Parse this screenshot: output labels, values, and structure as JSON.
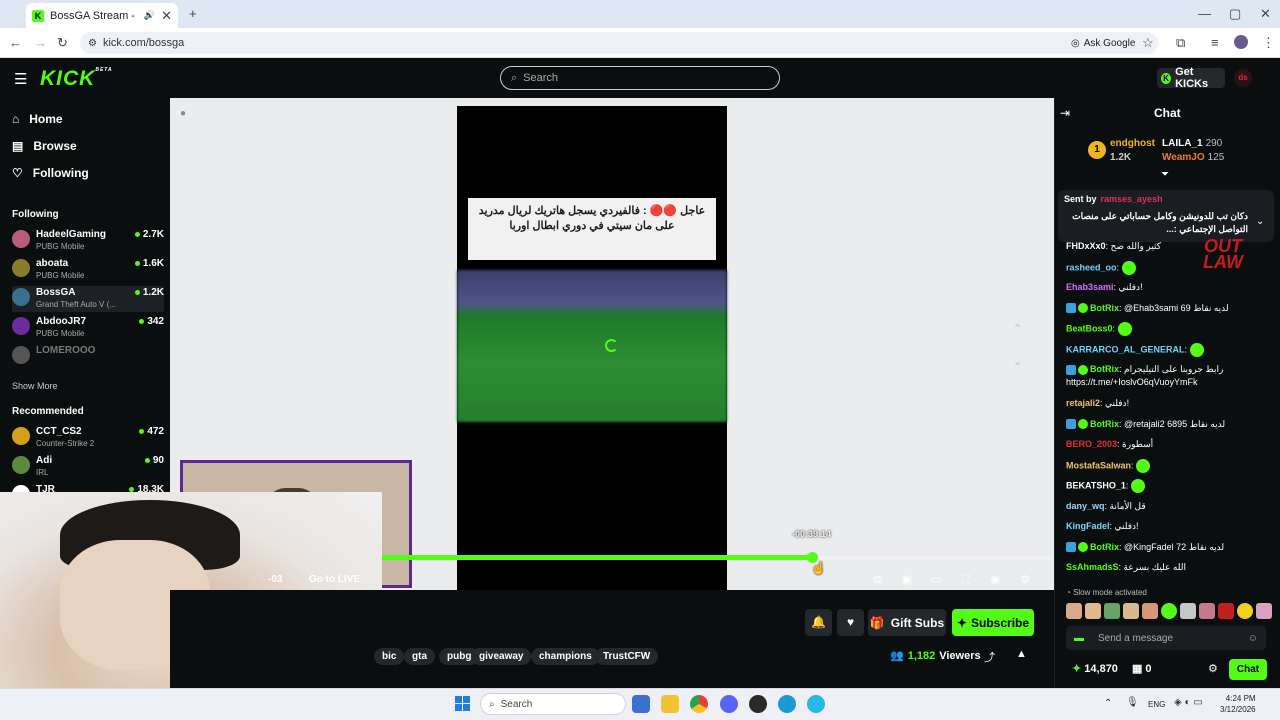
{
  "browser": {
    "tab_title": "BossGA Stream - Watch Live",
    "url": "kick.com/bossga",
    "ask_google": "Ask Google"
  },
  "header": {
    "logo": "KICK",
    "logo_badge": "BETA",
    "search_placeholder": "Search",
    "get_kicks": "Get KICKs"
  },
  "sidebar": {
    "nav": [
      {
        "label": "Home",
        "icon": "home-icon"
      },
      {
        "label": "Browse",
        "icon": "browse-icon"
      },
      {
        "label": "Following",
        "icon": "heart-icon"
      }
    ],
    "following_title": "Following",
    "following": [
      {
        "name": "HadeelGaming",
        "game": "PUBG Mobile",
        "viewers": "2.7K",
        "color": "#b85c7a"
      },
      {
        "name": "aboata",
        "game": "PUBG Mobile",
        "viewers": "1.6K",
        "color": "#8a7a2a"
      },
      {
        "name": "BossGA",
        "game": "Grand Theft Auto V (...",
        "viewers": "1.2K",
        "color": "#3b6e8f"
      },
      {
        "name": "AbdooJR7",
        "game": "PUBG Mobile",
        "viewers": "342",
        "color": "#6a2ca0"
      },
      {
        "name": "LOMEROOO",
        "game": "",
        "viewers": "",
        "color": "#555555"
      }
    ],
    "show_more": "Show More",
    "recommended_title": "Recommended",
    "recommended": [
      {
        "name": "CCT_CS2",
        "game": "Counter-Strike 2",
        "viewers": "472",
        "color": "#d4a017"
      },
      {
        "name": "Adi",
        "game": "IRL",
        "viewers": "90",
        "color": "#5a8a3a"
      },
      {
        "name": "TJR",
        "game": "IRL",
        "viewers": "18.3K",
        "color": "#ffffff"
      }
    ]
  },
  "player": {
    "news_text": "عاجل 🔴🔴 : فالفيردي يسجل هاتريك لريال مدريد على مان سيتي في دوري ابطال اوربا",
    "tooltip_time": "-00:39:14",
    "time": "-03",
    "go_live": "Go to LIVE",
    "progress_fraction": 0.703
  },
  "below": {
    "gift_subs": "Gift Subs",
    "subscribe": "Subscribe",
    "tags": [
      "bic",
      "gta",
      "pubg",
      "giveaway",
      "champions",
      "TrustCFW"
    ],
    "viewers_count": "1,182",
    "viewers_label": "Viewers"
  },
  "chat": {
    "title": "Chat",
    "leaderboard": [
      {
        "rank": "1",
        "name": "endghost",
        "amount": "1.2K"
      },
      {
        "name": "LAILA_1",
        "amount": "290"
      },
      {
        "name": "WeamJO",
        "amount": "125"
      }
    ],
    "pinned_sent_by": "Sent by",
    "pinned_user": "ramses_ayesh",
    "pinned_message": "دكان تب للدونيشن وكامل حساباتي على منصات التواصل الإجتماعي :...",
    "messages": [
      {
        "user": "FHDxXx0",
        "text": "كثير والله صح",
        "color": "#ffffff",
        "bot": false
      },
      {
        "user": "rasheed_oo",
        "text": "",
        "color": "#6fd3ff",
        "bot": false,
        "emote": true
      },
      {
        "user": "Ehab3sami",
        "text": "دفلني!",
        "color": "#d86bff",
        "bot": false
      },
      {
        "user": "BotRix",
        "text": "@Ehab3sami 69 لديه نقاط",
        "color": "#53fc18",
        "bot": true
      },
      {
        "user": "BeatBoss0",
        "text": "",
        "color": "#53fc18",
        "bot": false,
        "emote": true
      },
      {
        "user": "KARRARCO_AL_GENERAL",
        "text": "",
        "color": "#6fd3ff",
        "bot": false,
        "emote": true
      },
      {
        "user": "BotRix",
        "text": "رابط جروبنا على التيليجرام https://t.me/+IoslvO6qVuoyYmFk",
        "color": "#53fc18",
        "bot": true
      },
      {
        "user": "retajali2",
        "text": "دفلني!",
        "color": "#f0c36b",
        "bot": false
      },
      {
        "user": "BotRix",
        "text": "@retajali2 6895 لديه نقاط",
        "color": "#53fc18",
        "bot": true
      },
      {
        "user": "BERO_2003",
        "text": "أسطورة",
        "color": "#e03030",
        "bot": false
      },
      {
        "user": "MostafaSalwan",
        "text": "",
        "color": "#f0c36b",
        "bot": false,
        "emote": true
      },
      {
        "user": "BEKATSHO_1",
        "text": "",
        "color": "#ffffff",
        "bot": false,
        "emote": true
      },
      {
        "user": "dany_wq",
        "text": "قل الأمانة",
        "color": "#9fd3ff",
        "bot": false
      },
      {
        "user": "KingFadel",
        "text": "دفلني!",
        "color": "#7fd3ff",
        "bot": false
      },
      {
        "user": "BotRix",
        "text": "@KingFadel 72 لديه نقاط",
        "color": "#53fc18",
        "bot": true
      },
      {
        "user": "SsAhmadsS",
        "text": "الله عليك بسرعة",
        "color": "#53fc18",
        "bot": false
      }
    ],
    "slow_mode": "Slow mode activated",
    "send_placeholder": "Send a message",
    "balance": "14,870",
    "gifts": "0",
    "chat_button": "Chat",
    "overlay_logo": "OUT LAW"
  },
  "taskbar": {
    "search": "Search",
    "lang": "ENG",
    "time": "4:24 PM",
    "date": "3/12/2026"
  }
}
